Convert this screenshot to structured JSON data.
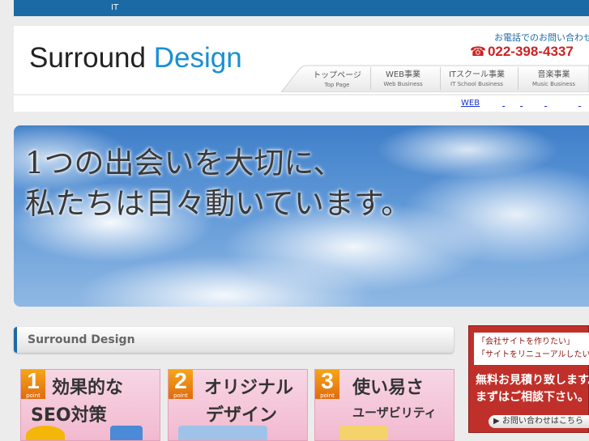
{
  "topbar": {
    "text": "IT"
  },
  "header": {
    "logo": {
      "part1": "Surround ",
      "part2": "Design"
    },
    "contact": {
      "label": "お電話でのお問い合わせ",
      "phone": "022-398-4337"
    }
  },
  "nav": {
    "items": [
      {
        "jp": "トップページ",
        "en": "Top Page"
      },
      {
        "jp": "WEB事業",
        "en": "Web Business"
      },
      {
        "jp": "ITスクール事業",
        "en": "IT School Business"
      },
      {
        "jp": "音楽事業",
        "en": "Music Business"
      }
    ]
  },
  "subnav": {
    "links": [
      "WEB",
      "",
      "",
      "",
      ""
    ]
  },
  "hero": {
    "line1": "1つの出会いを大切に、",
    "line2": "私たちは日々動いています。"
  },
  "section": {
    "title": "Surround Design"
  },
  "cards": [
    {
      "num": "1",
      "point": "point",
      "line1": "効果的な",
      "line2": "SEO対策"
    },
    {
      "num": "2",
      "point": "point",
      "line1": "オリジナル",
      "line2": "デザイン"
    },
    {
      "num": "3",
      "point": "point",
      "line1": "使い易さ",
      "line2": "ユーザビリティ"
    }
  ],
  "promo": {
    "quote1": "「会社サイトを作りたい」",
    "quote2": "「サイトをリニューアルしたい」",
    "big1": "無料お見積り致します。",
    "big2": "まずはご相談下さい。",
    "button": "▶ お問い合わせはこちら"
  },
  "colors": {
    "brand": "#1b6aa6",
    "accent": "#1a8fd1",
    "phone": "#cc2222",
    "promo": "#c0302a"
  }
}
